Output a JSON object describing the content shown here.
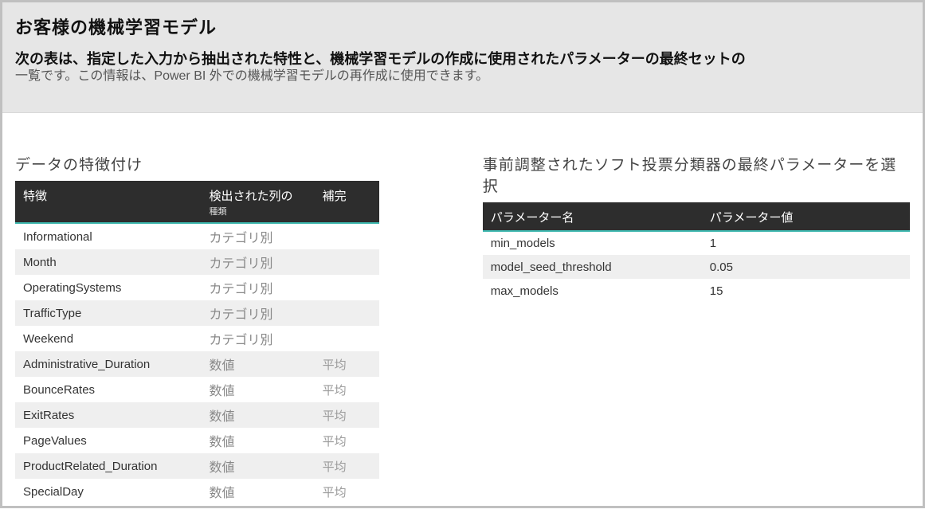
{
  "header": {
    "title": "お客様の機械学習モデル",
    "subtitle_strong": "次の表は、指定した入力から抽出された特性と、機械学習モデルの作成に使用されたパラメーターの最終セットの",
    "subtitle_light": "一覧です。この情報は、Power BI 外での機械学習モデルの再作成に使用できます。"
  },
  "features": {
    "section_title": "データの特徴付け",
    "columns": {
      "feature": "特徴",
      "kind": "検出された列の",
      "kind_sub": "種類",
      "imputation": "補完"
    },
    "rows": [
      {
        "feature": "Informational",
        "kind": "カテゴリ別",
        "imputation": ""
      },
      {
        "feature": "Month",
        "kind": "カテゴリ別",
        "imputation": ""
      },
      {
        "feature": "OperatingSystems",
        "kind": "カテゴリ別",
        "imputation": ""
      },
      {
        "feature": "TrafficType",
        "kind": "カテゴリ別",
        "imputation": ""
      },
      {
        "feature": "Weekend",
        "kind": "カテゴリ別",
        "imputation": ""
      },
      {
        "feature": "Administrative_Duration",
        "kind": "数値",
        "imputation": "平均"
      },
      {
        "feature": "BounceRates",
        "kind": "数値",
        "imputation": "平均"
      },
      {
        "feature": "ExitRates",
        "kind": "数値",
        "imputation": "平均"
      },
      {
        "feature": "PageValues",
        "kind": "数値",
        "imputation": "平均"
      },
      {
        "feature": "ProductRelated_Duration",
        "kind": "数値",
        "imputation": "平均"
      },
      {
        "feature": "SpecialDay",
        "kind": "数値",
        "imputation": "平均"
      }
    ]
  },
  "params": {
    "section_title": "事前調整されたソフト投票分類器の最終パラメーターを選択",
    "columns": {
      "name": "パラメーター名",
      "value": "パラメーター値"
    },
    "rows": [
      {
        "name": "min_models",
        "value": "1"
      },
      {
        "name": "model_seed_threshold",
        "value": "0.05"
      },
      {
        "name": "max_models",
        "value": "15"
      }
    ]
  }
}
